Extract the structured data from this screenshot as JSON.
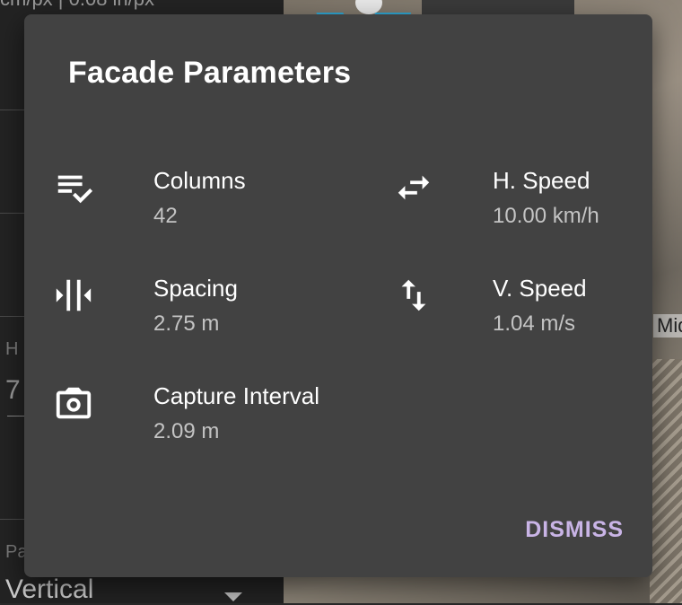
{
  "background": {
    "scale_text": "cm/px | 0.08 in/px",
    "field_label_h": "H",
    "field_value": "7",
    "field_label_p": "Pa",
    "pattern_value": "Vertical",
    "map_label": "Mid"
  },
  "dialog": {
    "title": "Facade Parameters",
    "params": {
      "columns": {
        "label": "Columns",
        "value": "42",
        "icon": "playlist-check-icon"
      },
      "h_speed": {
        "label": "H. Speed",
        "value": "10.00 km/h",
        "icon": "swap-horizontal-icon"
      },
      "spacing": {
        "label": "Spacing",
        "value": "2.75 m",
        "icon": "arrow-split-vertical-icon"
      },
      "v_speed": {
        "label": "V. Speed",
        "value": "1.04 m/s",
        "icon": "swap-vertical-icon"
      },
      "capture_interval": {
        "label": "Capture Interval",
        "value": "2.09 m",
        "icon": "camera-icon"
      }
    },
    "dismiss_label": "DISMISS"
  },
  "colors": {
    "dialog_bg": "#424242",
    "accent": "#c9b4e6",
    "secondary_text": "#c4c4c4"
  }
}
